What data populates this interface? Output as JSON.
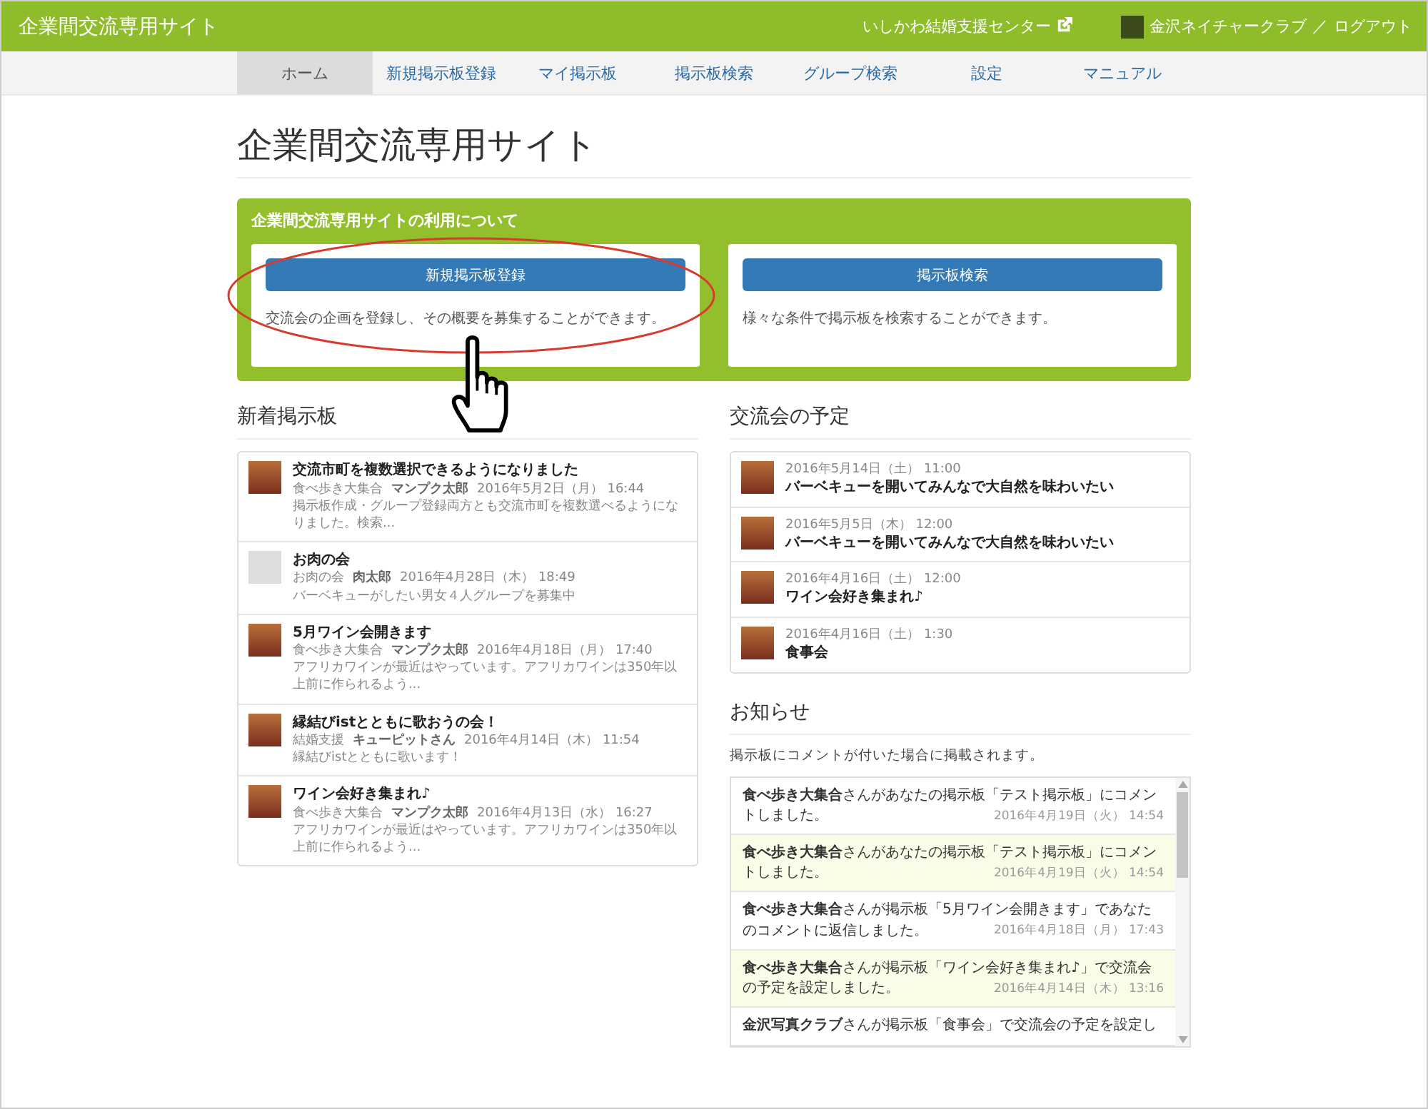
{
  "header": {
    "site_title": "企業間交流専用サイト",
    "external_link": "いしかわ結婚支援センター",
    "user_name": "金沢ネイチャークラブ",
    "separator": "／",
    "logout": "ログアウト"
  },
  "nav": [
    {
      "label": "ホーム",
      "selected": true
    },
    {
      "label": "新規掲示板登録",
      "selected": false
    },
    {
      "label": "マイ掲示板",
      "selected": false
    },
    {
      "label": "掲示板検索",
      "selected": false
    },
    {
      "label": "グループ検索",
      "selected": false
    },
    {
      "label": "設定",
      "selected": false
    },
    {
      "label": "マニュアル",
      "selected": false
    }
  ],
  "page_title": "企業間交流専用サイト",
  "intro": {
    "heading": "企業間交流専用サイトの利用について",
    "cards": [
      {
        "button": "新規掲示板登録",
        "text": "交流会の企画を登録し、その概要を募集することができます。",
        "highlighted": true
      },
      {
        "button": "掲示板検索",
        "text": "様々な条件で掲示板を検索することができます。",
        "highlighted": false
      }
    ]
  },
  "new_posts": {
    "heading": "新着掲示板",
    "items": [
      {
        "kind": "photo",
        "title": "交流市町を複数選択できるようになりました",
        "group": "食べ歩き大集合",
        "author": "マンプク太郎",
        "date": "2016年5月2日（月） 16:44",
        "excerpt": "掲示板作成・グループ登録両方とも交流市町を複数選べるようになりました。検索..."
      },
      {
        "kind": "none",
        "title": "お肉の会",
        "group": "お肉の会",
        "author": "肉太郎",
        "date": "2016年4月28日（木） 18:49",
        "excerpt": "バーベキューがしたい男女４人グループを募集中"
      },
      {
        "kind": "photo",
        "title": "5月ワイン会開きます",
        "group": "食べ歩き大集合",
        "author": "マンプク太郎",
        "date": "2016年4月18日（月） 17:40",
        "excerpt": "アフリカワインが最近はやっています。アフリカワインは350年以上前に作られるよう..."
      },
      {
        "kind": "photo",
        "title": "縁結びistとともに歌おうの会！",
        "group": "結婚支援",
        "author": "キューピットさん",
        "date": "2016年4月14日（木） 11:54",
        "excerpt": "縁結びistとともに歌います！"
      },
      {
        "kind": "photo",
        "title": "ワイン会好き集まれ♪",
        "group": "食べ歩き大集合",
        "author": "マンプク太郎",
        "date": "2016年4月13日（水） 16:27",
        "excerpt": "アフリカワインが最近はやっています。アフリカワインは350年以上前に作られるよう..."
      }
    ]
  },
  "events": {
    "heading": "交流会の予定",
    "items": [
      {
        "date": "2016年5月14日（土） 11:00",
        "title": "バーベキューを開いてみんなで大自然を味わいたい"
      },
      {
        "date": "2016年5月5日（木） 12:00",
        "title": "バーベキューを開いてみんなで大自然を味わいたい"
      },
      {
        "date": "2016年4月16日（土） 12:00",
        "title": "ワイン会好き集まれ♪"
      },
      {
        "date": "2016年4月16日（土） 1:30",
        "title": "食事会"
      }
    ]
  },
  "notices": {
    "heading": "お知らせ",
    "description": "掲示板にコメントが付いた場合に掲載されます。",
    "items": [
      {
        "text": "**食べ歩き大集合**さんがあなたの掲示板「テスト掲示板」にコメントしました。",
        "date": "2016年4月19日（火） 14:54",
        "highlighted": false
      },
      {
        "text": "**食べ歩き大集合**さんがあなたの掲示板「テスト掲示板」にコメントしました。",
        "date": "2016年4月19日（火） 14:54",
        "highlighted": true
      },
      {
        "text": "**食べ歩き大集合**さんが掲示板「5月ワイン会開きます」であなたのコメントに返信しました。",
        "date": "2016年4月18日（月） 17:43",
        "highlighted": false
      },
      {
        "text": "**食べ歩き大集合**さんが掲示板「ワイン会好き集まれ♪」で交流会の予定を設定しました。",
        "date": "2016年4月14日（木） 13:16",
        "highlighted": true
      },
      {
        "text": "**金沢写真クラブ**さんが掲示板「食事会」で交流会の予定を設定し",
        "highlighted": false
      }
    ]
  }
}
